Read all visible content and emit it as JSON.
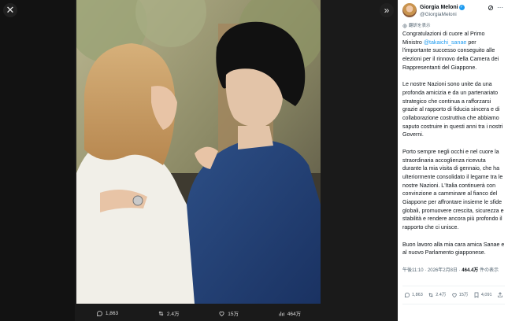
{
  "post": {
    "author_name": "Giorgia Meloni",
    "author_handle": "@GiorgiaMeloni",
    "translate_label": "翻訳を表示",
    "paragraphs": [
      [
        "Congratulazioni di cuore al Primo Ministro ",
        "@takaichi_sanae",
        " per l'importante successo conseguito alle elezioni per il rinnovo della Camera dei Rappresentanti del Giappone."
      ],
      [
        "Le nostre Nazioni sono unite da una profonda amicizia e da un partenariato strategico che continua a rafforzarsi grazie al rapporto di fiducia sincera e di collaborazione costruttiva che abbiamo saputo costruire in questi anni tra i nostri Governi."
      ],
      [
        "Porto sempre negli occhi e nel cuore la straordinaria accoglienza ricevuta durante la mia visita di gennaio, che ha ulteriormente consolidato il legame tra le nostre Nazioni. L'Italia continuerà con convinzione a camminare al fianco del Giappone per affrontare insieme le sfide globali, promuovere crescita, sicurezza e stabilità e rendere ancora più profondo il rapporto che ci unisce."
      ],
      [
        "Buon lavoro alla mia cara amica Sanae e al nuovo Parlamento giapponese."
      ]
    ],
    "timestamp": "午後11:10 · 2026年2月8日 · ",
    "views_count": "464.4万",
    "views_label": " 件の表示"
  },
  "media_bar": {
    "replies": "1,863",
    "reposts": "2.4万",
    "likes": "15万",
    "views": "464万"
  },
  "panel_bar": {
    "replies": "1,863",
    "reposts": "2.4万",
    "likes": "15万",
    "bookmarks": "4,091"
  },
  "colors": {
    "accent": "#1d9bf0",
    "muted": "#536471",
    "text": "#0f1419"
  }
}
